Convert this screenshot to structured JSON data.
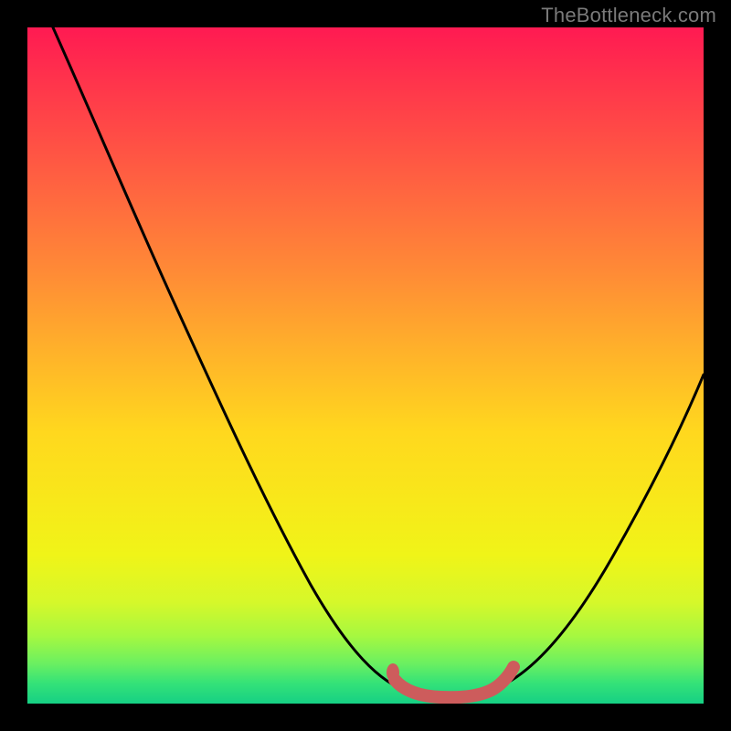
{
  "attribution": "TheBottleneck.com",
  "colors": {
    "curve": "#000000",
    "marker": "#cd5c5c",
    "background_top": "#ff1a52",
    "background_bottom": "#16d084"
  },
  "chart_data": {
    "type": "line",
    "title": "",
    "xlabel": "",
    "ylabel": "",
    "xlim": [
      0,
      100
    ],
    "ylim": [
      0,
      100
    ],
    "grid": false,
    "legend": false,
    "series": [
      {
        "name": "bottleneck-curve",
        "x": [
          0,
          8,
          16,
          24,
          32,
          40,
          48,
          54,
          58,
          62,
          66,
          70,
          76,
          82,
          88,
          94,
          100
        ],
        "y": [
          108,
          92,
          76,
          60,
          44,
          29,
          15,
          6,
          2,
          1,
          1,
          2,
          6,
          14,
          24,
          36,
          50
        ]
      },
      {
        "name": "optimal-range-marker",
        "x": [
          56,
          58,
          60,
          64,
          68,
          70,
          71
        ],
        "y": [
          4,
          2,
          1.5,
          1.3,
          1.5,
          3,
          5
        ]
      }
    ],
    "annotations": []
  }
}
